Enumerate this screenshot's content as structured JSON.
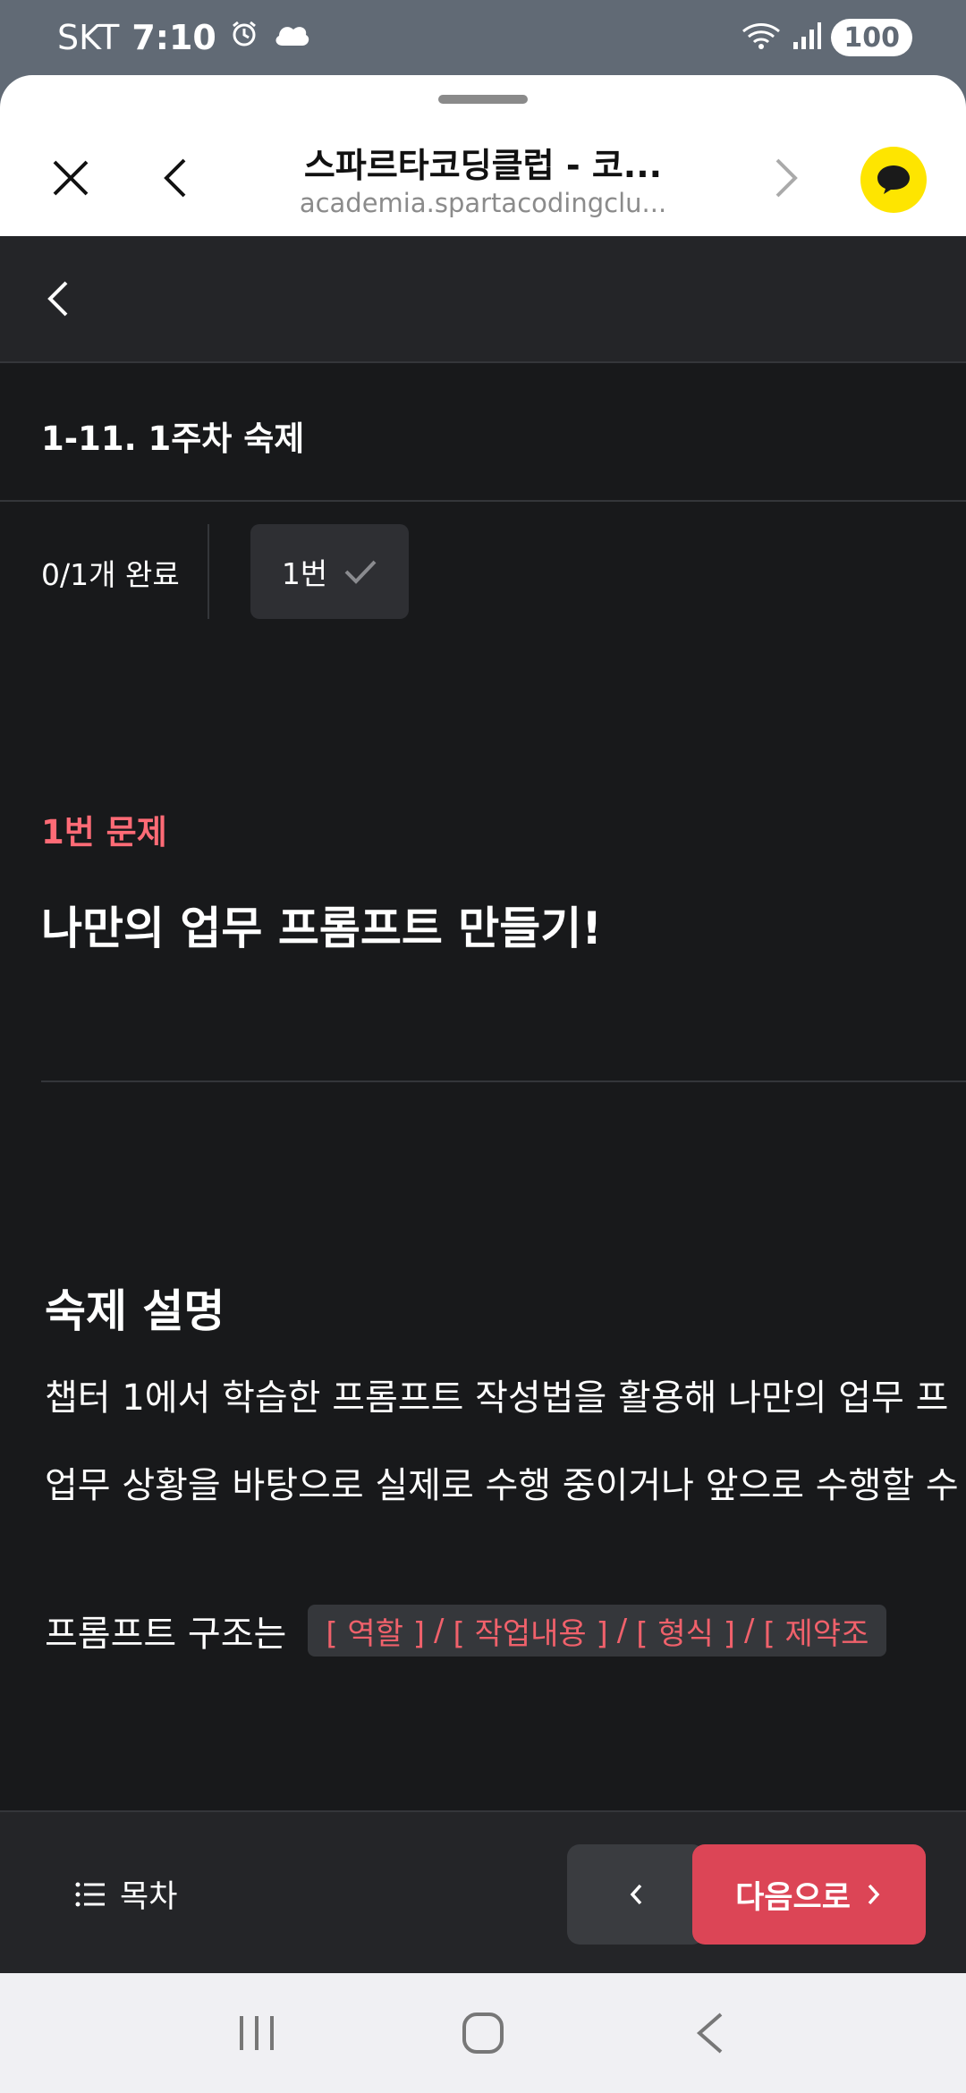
{
  "status_bar": {
    "carrier": "SKT",
    "time": "7:10",
    "battery": "100"
  },
  "browser": {
    "title": "스파르타코딩클럽 - 코...",
    "url": "academia.spartacodingclu..."
  },
  "lesson": {
    "title": "1-11. 1주차 숙제",
    "progress": "0/1개 완료",
    "chip_label": "1번"
  },
  "question": {
    "label": "1번 문제",
    "title": "나만의 업무 프롬프트 만들기!"
  },
  "section": {
    "title": "숙제 설명",
    "paragraph1": "챕터 1에서 학습한 프롬프트 작성법을 활용해 나만의 업무 프",
    "paragraph2": "업무 상황을 바탕으로 실제로 수행 중이거나 앞으로 수행할 수",
    "structure_label": "프롬프트 구조는",
    "structure_items": [
      "[ 역할 ]",
      "[ 작업내용 ]",
      "[ 형식 ]",
      "[ 제약조"
    ],
    "separator": "/"
  },
  "bottom_bar": {
    "toc_label": "목차",
    "next_label": "다음으로"
  },
  "colors": {
    "accent": "#dc4556",
    "question_label": "#ff6b76",
    "code_text": "#f0616b",
    "kakao": "#fee500"
  }
}
